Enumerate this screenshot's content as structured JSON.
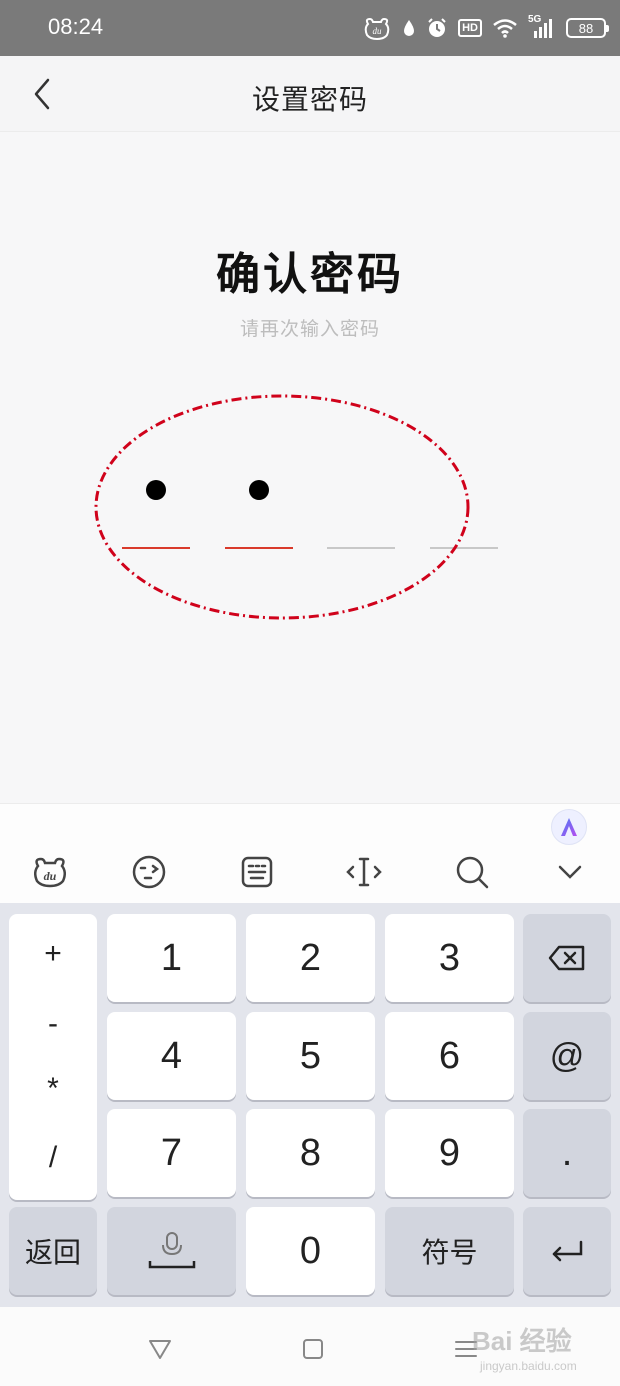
{
  "status_bar": {
    "time": "08:24",
    "signal_label": "5G",
    "battery": "88",
    "hd_label": "HD",
    "icons": [
      "du-keyboard-icon",
      "water-drop-icon",
      "alarm-icon",
      "hd-icon",
      "wifi-icon",
      "signal-icon",
      "battery-icon"
    ]
  },
  "nav": {
    "title": "设置密码",
    "back_icon": "chevron-left-icon"
  },
  "content": {
    "heading": "确认密码",
    "subheading": "请再次输入密码",
    "pin_length": 4,
    "pin_filled": 2,
    "accent_color": "#d93a2b",
    "annotation_color": "#d0021b"
  },
  "keyboard": {
    "toolbar_icons": [
      "du-logo-icon",
      "emoji-icon",
      "keyboard-layout-icon",
      "cursor-move-icon",
      "search-icon",
      "collapse-chevron-icon"
    ],
    "assist_icon": "assistant-a-icon",
    "symbols": [
      "+",
      "-",
      "*",
      "/"
    ],
    "digits": [
      "1",
      "2",
      "3",
      "4",
      "5",
      "6",
      "7",
      "8",
      "9",
      "0"
    ],
    "right_keys": [
      "@",
      "."
    ],
    "back_label": "返回",
    "symbols_label": "符号",
    "backspace_icon": "backspace-icon",
    "mic_icon": "mic-space-icon",
    "enter_icon": "enter-icon"
  },
  "system_nav": {
    "icons": [
      "back-triangle-icon",
      "home-square-icon",
      "menu-lines-icon"
    ],
    "watermark": "Bai 经验",
    "watermark_sub": "jingyan.baidu.com"
  }
}
